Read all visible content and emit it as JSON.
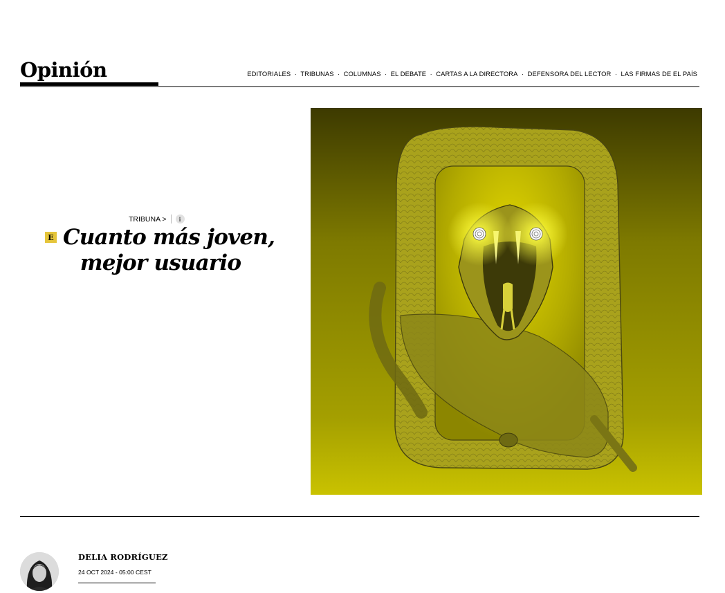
{
  "header": {
    "section_title": "Opinión",
    "nav": [
      {
        "label": "EDITORIALES"
      },
      {
        "label": "TRIBUNAS"
      },
      {
        "label": "COLUMNAS"
      },
      {
        "label": "EL DEBATE"
      },
      {
        "label": "CARTAS A LA DIRECTORA"
      },
      {
        "label": "DEFENSORA DEL LECTOR"
      },
      {
        "label": "LAS FIRMAS DE EL PAÍS"
      }
    ],
    "separator": "·"
  },
  "article": {
    "kicker": "TRIBUNA >",
    "info_icon_glyph": "i",
    "exclusive_badge": "E",
    "headline_line1": "Cuanto más joven,",
    "headline_line2": "mejor usuario",
    "illustration_icon": "snake-phone-illustration"
  },
  "author": {
    "name": "DELIA RODRÍGUEZ",
    "date": "24 OCT 2024 - 05:00 CEST"
  },
  "colors": {
    "accent_yellow": "#e5c53b",
    "illustration_bg": "#b9b300",
    "text": "#000000"
  }
}
